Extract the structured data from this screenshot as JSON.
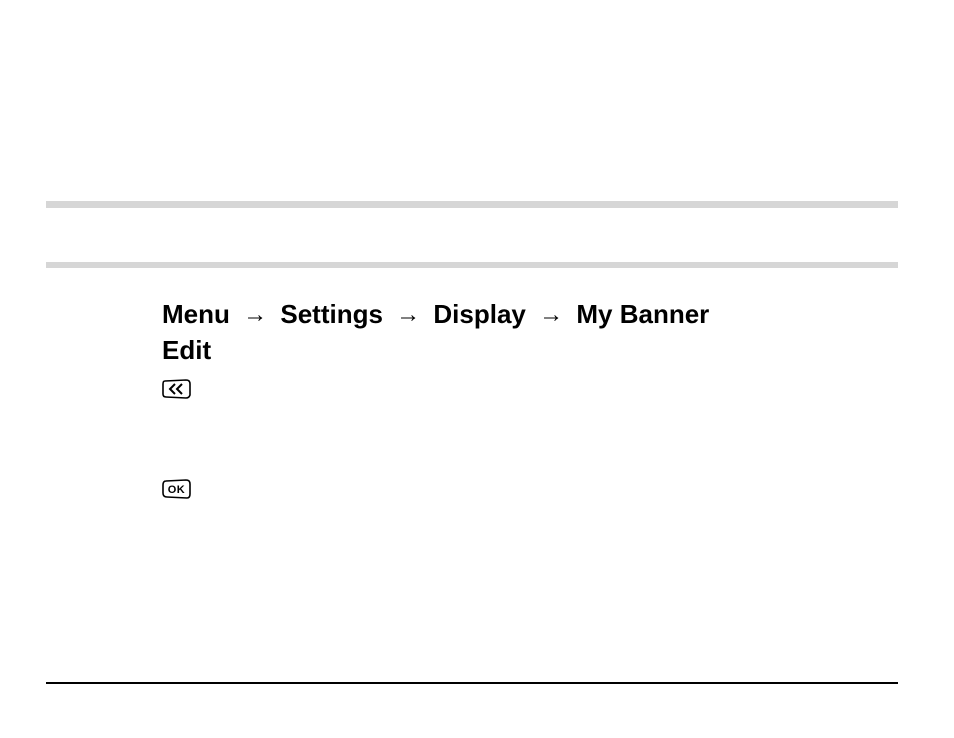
{
  "breadcrumb": {
    "items": [
      "Menu",
      "Settings",
      "Display",
      "My Banner"
    ],
    "trailing": "Edit"
  },
  "icons": {
    "back": "back-key-icon",
    "ok": "ok-key-icon"
  }
}
